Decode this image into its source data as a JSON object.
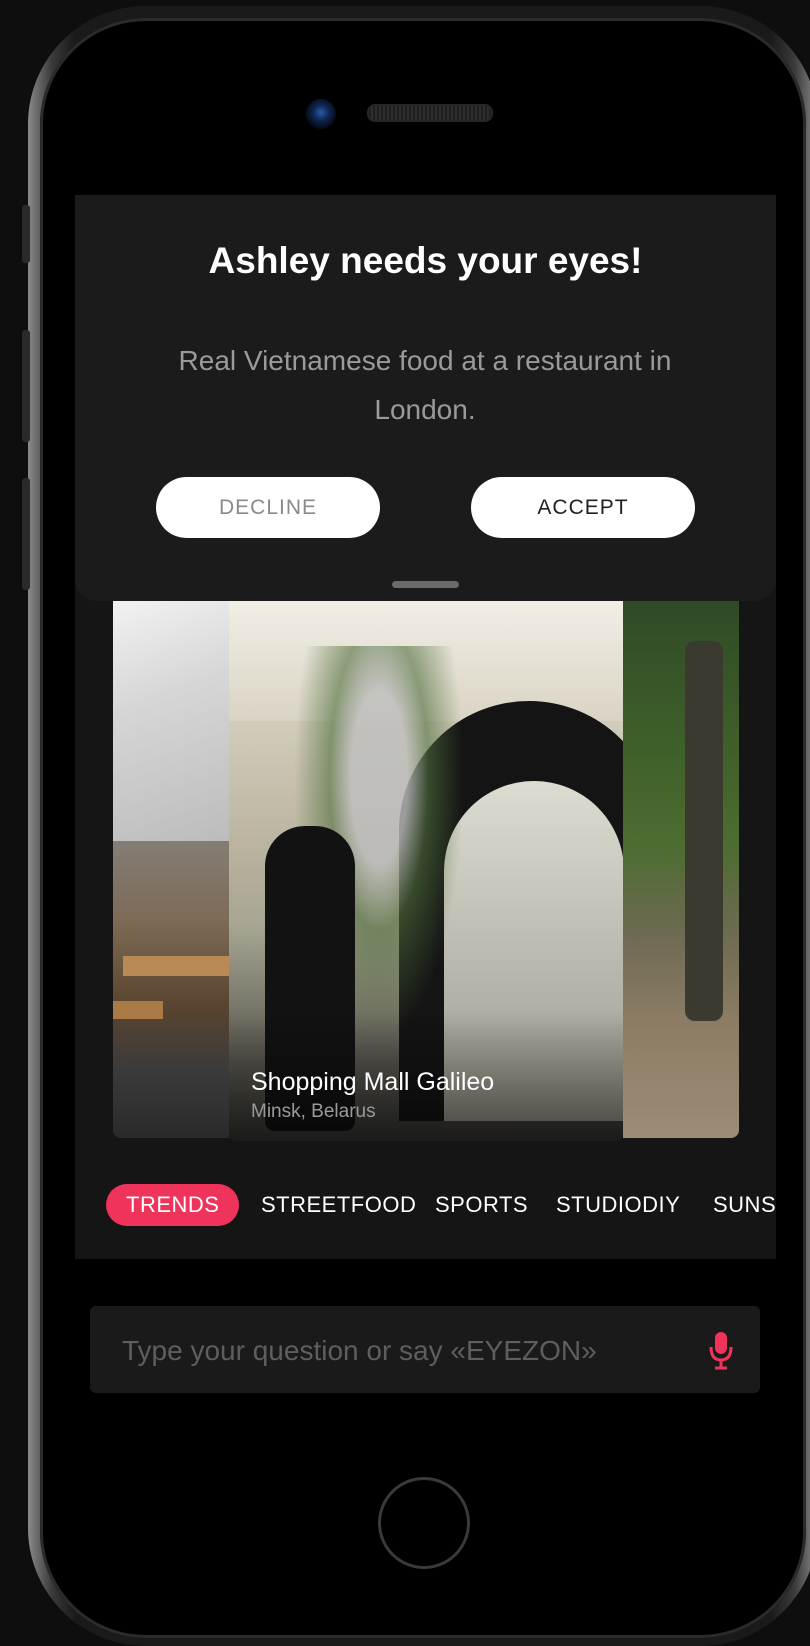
{
  "modal": {
    "title": "Ashley needs your eyes!",
    "message": "Real Vietnamese food at a restaurant in London.",
    "decline_label": "DECLINE",
    "accept_label": "ACCEPT"
  },
  "carousel": {
    "featured": {
      "title": "Shopping Mall Galileo",
      "subtitle": "Minsk, Belarus"
    }
  },
  "categories": [
    {
      "label": "TRENDS",
      "active": true
    },
    {
      "label": "STREETFOOD",
      "active": false
    },
    {
      "label": "SPORTS",
      "active": false
    },
    {
      "label": "STUDIODIY",
      "active": false
    },
    {
      "label": "SUNS",
      "active": false
    }
  ],
  "ask": {
    "placeholder": "Type your question or say «EYEZON»",
    "mic_icon": "microphone-icon"
  },
  "colors": {
    "accent": "#f0335a",
    "background": "#0e0e0e",
    "card": "#1b1b1b"
  }
}
